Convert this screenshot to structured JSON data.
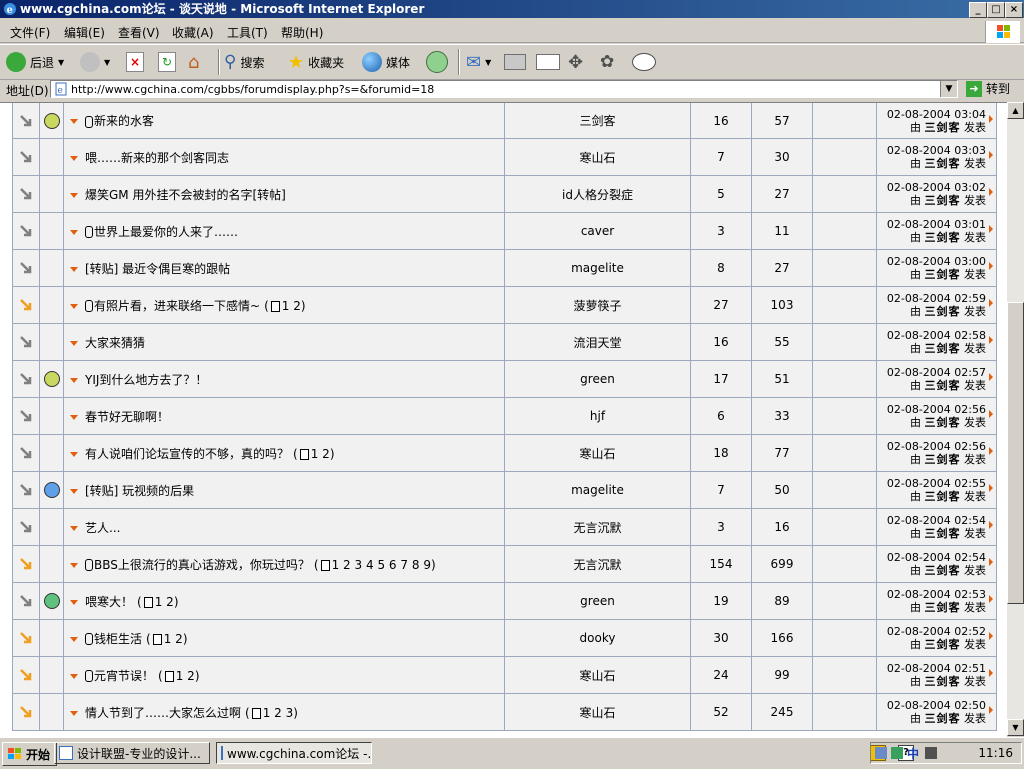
{
  "window": {
    "title": "www.cgchina.com论坛 - 谈天说地 - Microsoft Internet Explorer",
    "controls": [
      "_",
      "□",
      "×"
    ]
  },
  "menu": [
    "文件(F)",
    "编辑(E)",
    "查看(V)",
    "收藏(A)",
    "工具(T)",
    "帮助(H)"
  ],
  "toolbar": {
    "back": "后退",
    "search": "搜索",
    "favorites": "收藏夹",
    "media": "媒体"
  },
  "address": {
    "label": "地址(D)",
    "url": "http://www.cgchina.com/cgbbs/forumdisplay.php?s=&forumid=18",
    "go": "转到"
  },
  "colors": {
    "hot_arrow": "#f0a020",
    "normal_arrow": "#808080",
    "triangle": "#e06010",
    "title_bar": "#0a246a"
  },
  "threads": [
    {
      "hot": false,
      "face": "smile",
      "has_post": true,
      "title": "新来的水客",
      "pages": [],
      "author": "三剑客",
      "replies": "16",
      "views": "57",
      "last_date": "02-08-2004 03:04",
      "last_by": "由",
      "last_user": "三剑客",
      "last_action": "发表"
    },
    {
      "hot": false,
      "face": "",
      "has_post": false,
      "title": "喂……新来的那个剑客同志",
      "pages": [],
      "author": "寒山石",
      "replies": "7",
      "views": "30",
      "last_date": "02-08-2004 03:03",
      "last_by": "由",
      "last_user": "三剑客",
      "last_action": "发表"
    },
    {
      "hot": false,
      "face": "",
      "has_post": false,
      "title": "爆笑GM 用外挂不会被封的名字[转帖]",
      "pages": [],
      "author": "id人格分裂症",
      "replies": "5",
      "views": "27",
      "last_date": "02-08-2004 03:02",
      "last_by": "由",
      "last_user": "三剑客",
      "last_action": "发表"
    },
    {
      "hot": false,
      "face": "",
      "has_post": true,
      "title": "世界上最爱你的人来了……",
      "pages": [],
      "author": "caver",
      "replies": "3",
      "views": "11",
      "last_date": "02-08-2004 03:01",
      "last_by": "由",
      "last_user": "三剑客",
      "last_action": "发表"
    },
    {
      "hot": false,
      "face": "",
      "has_post": false,
      "title": "[转贴] 最近令偶巨寒的跟帖",
      "pages": [],
      "author": "magelite",
      "replies": "8",
      "views": "27",
      "last_date": "02-08-2004 03:00",
      "last_by": "由",
      "last_user": "三剑客",
      "last_action": "发表"
    },
    {
      "hot": true,
      "face": "",
      "has_post": true,
      "title": "有照片看，进来联络一下感情~",
      "pages": [
        "1",
        "2"
      ],
      "author": "菠萝筷子",
      "replies": "27",
      "views": "103",
      "last_date": "02-08-2004 02:59",
      "last_by": "由",
      "last_user": "三剑客",
      "last_action": "发表"
    },
    {
      "hot": false,
      "face": "",
      "has_post": false,
      "title": "大家来猜猜",
      "pages": [],
      "author": "流泪天堂",
      "replies": "16",
      "views": "55",
      "last_date": "02-08-2004 02:58",
      "last_by": "由",
      "last_user": "三剑客",
      "last_action": "发表"
    },
    {
      "hot": false,
      "face": "smile",
      "has_post": false,
      "title": "YIJ到什么地方去了？！",
      "pages": [],
      "author": "green",
      "replies": "17",
      "views": "51",
      "last_date": "02-08-2004 02:57",
      "last_by": "由",
      "last_user": "三剑客",
      "last_action": "发表"
    },
    {
      "hot": false,
      "face": "",
      "has_post": false,
      "title": "春节好无聊啊！",
      "pages": [],
      "author": "hjf",
      "replies": "6",
      "views": "33",
      "last_date": "02-08-2004 02:56",
      "last_by": "由",
      "last_user": "三剑客",
      "last_action": "发表"
    },
    {
      "hot": false,
      "face": "",
      "has_post": false,
      "title": "有人说咱们论坛宣传的不够，真的吗？",
      "pages": [
        "1",
        "2"
      ],
      "author": "寒山石",
      "replies": "18",
      "views": "77",
      "last_date": "02-08-2004 02:56",
      "last_by": "由",
      "last_user": "三剑客",
      "last_action": "发表"
    },
    {
      "hot": false,
      "face": "blue",
      "has_post": false,
      "title": "[转贴] 玩视频的后果",
      "pages": [],
      "author": "magelite",
      "replies": "7",
      "views": "50",
      "last_date": "02-08-2004 02:55",
      "last_by": "由",
      "last_user": "三剑客",
      "last_action": "发表"
    },
    {
      "hot": false,
      "face": "",
      "has_post": false,
      "title": "艺人...",
      "pages": [],
      "author": "无言沉默",
      "replies": "3",
      "views": "16",
      "last_date": "02-08-2004 02:54",
      "last_by": "由",
      "last_user": "三剑客",
      "last_action": "发表"
    },
    {
      "hot": true,
      "face": "",
      "has_post": true,
      "title": "BBS上很流行的真心话游戏，你玩过吗？",
      "pages": [
        "1",
        "2",
        "3",
        "4",
        "5",
        "6",
        "7",
        "8",
        "9"
      ],
      "author": "无言沉默",
      "replies": "154",
      "views": "699",
      "last_date": "02-08-2004 02:54",
      "last_by": "由",
      "last_user": "三剑客",
      "last_action": "发表"
    },
    {
      "hot": false,
      "face": "green",
      "has_post": false,
      "title": "喂寒大！",
      "pages": [
        "1",
        "2"
      ],
      "author": "green",
      "replies": "19",
      "views": "89",
      "last_date": "02-08-2004 02:53",
      "last_by": "由",
      "last_user": "三剑客",
      "last_action": "发表"
    },
    {
      "hot": true,
      "face": "",
      "has_post": true,
      "title": "钱柜生活",
      "pages": [
        "1",
        "2"
      ],
      "author": "dooky",
      "replies": "30",
      "views": "166",
      "last_date": "02-08-2004 02:52",
      "last_by": "由",
      "last_user": "三剑客",
      "last_action": "发表"
    },
    {
      "hot": true,
      "face": "",
      "has_post": true,
      "title": "元宵节误！",
      "pages": [
        "1",
        "2"
      ],
      "author": "寒山石",
      "replies": "24",
      "views": "99",
      "last_date": "02-08-2004 02:51",
      "last_by": "由",
      "last_user": "三剑客",
      "last_action": "发表"
    },
    {
      "hot": true,
      "face": "",
      "has_post": false,
      "title": "情人节到了……大家怎么过啊",
      "pages": [
        "1",
        "2",
        "3"
      ],
      "author": "寒山石",
      "replies": "52",
      "views": "245",
      "last_date": "02-08-2004 02:50",
      "last_by": "由",
      "last_user": "三剑客",
      "last_action": "发表"
    }
  ],
  "taskbar": {
    "start": "开始",
    "tasks": [
      "设计联盟-专业的设计...",
      "www.cgchina.com论坛 -..."
    ],
    "ime": "中",
    "clock": "11:16"
  }
}
